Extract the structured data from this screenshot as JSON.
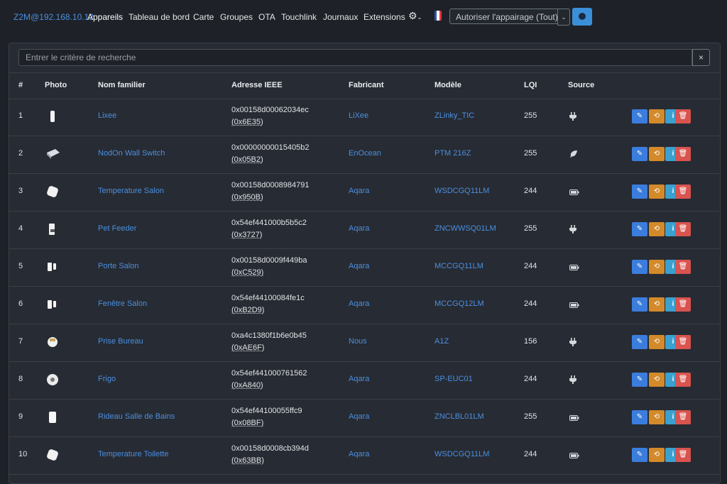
{
  "nav": {
    "brand": "Z2M@192.168.10.12",
    "items": [
      {
        "label": "Appareils",
        "active": true
      },
      {
        "label": "Tableau de bord"
      },
      {
        "label": "Carte"
      },
      {
        "label": "Groupes"
      },
      {
        "label": "OTA"
      },
      {
        "label": "Touchlink"
      },
      {
        "label": "Journaux"
      },
      {
        "label": "Extensions"
      }
    ],
    "settings_icon": "gear-icon",
    "language_icon": "flag-fr-icon",
    "permit_join_label": "Autoriser l'appairage (Tout)",
    "status_color": "#3a8fd8"
  },
  "search": {
    "placeholder": "Entrer le critère de recherche",
    "clear_label": "×"
  },
  "table": {
    "headers": [
      "#",
      "Photo",
      "Nom familier",
      "Adresse IEEE",
      "Fabricant",
      "Modèle",
      "LQI",
      "Source"
    ],
    "rows": [
      {
        "num": "1",
        "name": "Lixee",
        "ieee": "0x00158d00062034ec",
        "nwk": "(0x6E35)",
        "vendor": "LiXee",
        "model": "ZLinky_TIC",
        "lqi": "255",
        "source": "mains"
      },
      {
        "num": "2",
        "name": "NodOn Wall Switch",
        "ieee": "0x00000000015405b2",
        "nwk": "(0x05B2)",
        "vendor": "EnOcean",
        "model": "PTM 216Z",
        "lqi": "255",
        "source": "energy-harvest"
      },
      {
        "num": "3",
        "name": "Temperature Salon",
        "ieee": "0x00158d0008984791",
        "nwk": "(0x950B)",
        "vendor": "Aqara",
        "model": "WSDCGQ11LM",
        "lqi": "244",
        "source": "battery"
      },
      {
        "num": "4",
        "name": "Pet Feeder",
        "ieee": "0x54ef441000b5b5c2",
        "nwk": "(0x3727)",
        "vendor": "Aqara",
        "model": "ZNCWWSQ01LM",
        "lqi": "255",
        "source": "mains"
      },
      {
        "num": "5",
        "name": "Porte Salon",
        "ieee": "0x00158d0009f449ba",
        "nwk": "(0xC529)",
        "vendor": "Aqara",
        "model": "MCCGQ11LM",
        "lqi": "244",
        "source": "battery"
      },
      {
        "num": "6",
        "name": "Fenêtre Salon",
        "ieee": "0x54ef44100084fe1c",
        "nwk": "(0xB2D9)",
        "vendor": "Aqara",
        "model": "MCCGQ12LM",
        "lqi": "244",
        "source": "battery"
      },
      {
        "num": "7",
        "name": "Prise Bureau",
        "ieee": "0xa4c1380f1b6e0b45",
        "nwk": "(0xAE6F)",
        "vendor": "Nous",
        "model": "A1Z",
        "lqi": "156",
        "source": "mains"
      },
      {
        "num": "8",
        "name": "Frigo",
        "ieee": "0x54ef441000761562",
        "nwk": "(0xA840)",
        "vendor": "Aqara",
        "model": "SP-EUC01",
        "lqi": "244",
        "source": "mains"
      },
      {
        "num": "9",
        "name": "Rideau Salle de Bains",
        "ieee": "0x54ef44100055ffc9",
        "nwk": "(0x08BF)",
        "vendor": "Aqara",
        "model": "ZNCLBL01LM",
        "lqi": "255",
        "source": "battery"
      },
      {
        "num": "10",
        "name": "Temperature Toilette",
        "ieee": "0x00158d0008cb394d",
        "nwk": "(0x63BB)",
        "vendor": "Aqara",
        "model": "WSDCGQ11LM",
        "lqi": "244",
        "source": "battery"
      }
    ],
    "action_icons": [
      "edit-icon",
      "rename-icon",
      "info-icon",
      "trash-icon"
    ]
  },
  "colors": {
    "link": "#4a90e2",
    "edit": "#3b7ddd",
    "rename": "#d38a2b",
    "info": "#3aa0d0",
    "delete": "#d9534f"
  }
}
